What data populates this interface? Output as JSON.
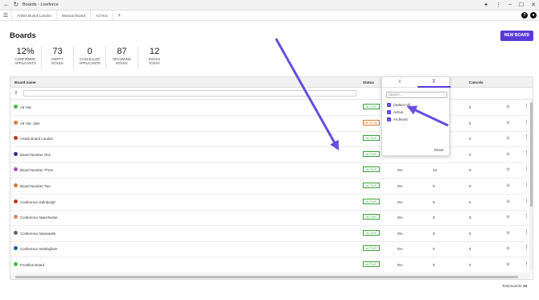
{
  "browser": {
    "back_icon": "arrow-left-icon",
    "reload_icon": "reload-icon",
    "title": "Boards - Liveforce"
  },
  "tabs": {
    "items": [
      {
        "label": "Artists Board London"
      },
      {
        "label": "Musical Board"
      },
      {
        "label": "Ad Hoc"
      }
    ],
    "add_label": "+"
  },
  "header": {
    "title": "Boards",
    "new_board_label": "NEW BOARD"
  },
  "stats": [
    {
      "value": "12%",
      "label1": "CONFIRMED",
      "label2": "APPLICANTS"
    },
    {
      "value": "73",
      "label1": "EMPTY",
      "label2": "ROLES"
    },
    {
      "value": "0",
      "label1": "CANCELLED",
      "label2": "APPLICANTS"
    },
    {
      "value": "87",
      "label1": "UPCOMING",
      "label2": "ROLES"
    },
    {
      "value": "12",
      "label1": "ROLES",
      "label2": "TODAY"
    }
  ],
  "table": {
    "columns": {
      "name": "Board name",
      "status": "Status",
      "cancels": "Cancels"
    },
    "rows": [
      {
        "name": "Ad Hoc",
        "color": "#3fbf3f",
        "status": "ACTIVE",
        "pct": "",
        "upcoming": "",
        "cancels": "0"
      },
      {
        "name": "Ad Hoc Jolie",
        "color": "#e07b30",
        "status": "ARCHIVED",
        "pct": "",
        "upcoming": "",
        "cancels": "0"
      },
      {
        "name": "Artists Board London",
        "color": "#c0392b",
        "status": "ACTIVE",
        "pct": "",
        "upcoming": "",
        "cancels": "0"
      },
      {
        "name": "Board Number One",
        "color": "#2c2f8f",
        "status": "ACTIVE",
        "pct": "",
        "upcoming": "",
        "cancels": "0"
      },
      {
        "name": "Board Number Three",
        "color": "#b050c8",
        "status": "ACTIVE",
        "pct": "0%",
        "upcoming": "24",
        "cancels": "0"
      },
      {
        "name": "Board Number Two",
        "color": "#e07b30",
        "status": "ACTIVE",
        "pct": "0%",
        "upcoming": "0",
        "cancels": "0"
      },
      {
        "name": "Conference Edinburgh",
        "color": "#c0392b",
        "status": "ACTIVE",
        "pct": "0%",
        "upcoming": "0",
        "cancels": "0"
      },
      {
        "name": "Conference Manchester",
        "color": "#e8806a",
        "status": "ACTIVE",
        "pct": "0%",
        "upcoming": "0",
        "cancels": "0"
      },
      {
        "name": "Conference Newcastle",
        "color": "#666666",
        "status": "ACTIVE",
        "pct": "0%",
        "upcoming": "0",
        "cancels": "0"
      },
      {
        "name": "Conference Nottingham",
        "color": "#1f5c9e",
        "status": "ACTIVE",
        "pct": "0%",
        "upcoming": "0",
        "cancels": "0"
      },
      {
        "name": "Frontline Board",
        "color": "#3fbf3f",
        "status": "ACTIVE",
        "pct": "0%",
        "upcoming": "0",
        "cancels": "0"
      }
    ]
  },
  "filter_popup": {
    "search_placeholder": "Search...",
    "options": [
      {
        "label": "(Select All)",
        "checked": true
      },
      {
        "label": "Active",
        "checked": true
      },
      {
        "label": "Archived",
        "checked": true
      }
    ],
    "reset_label": "Reset"
  },
  "footer": {
    "label": "Total Boards:",
    "count": "13"
  },
  "colors": {
    "accent": "#5b3bd8",
    "active": "#3aa53a",
    "archived": "#e07b30"
  }
}
